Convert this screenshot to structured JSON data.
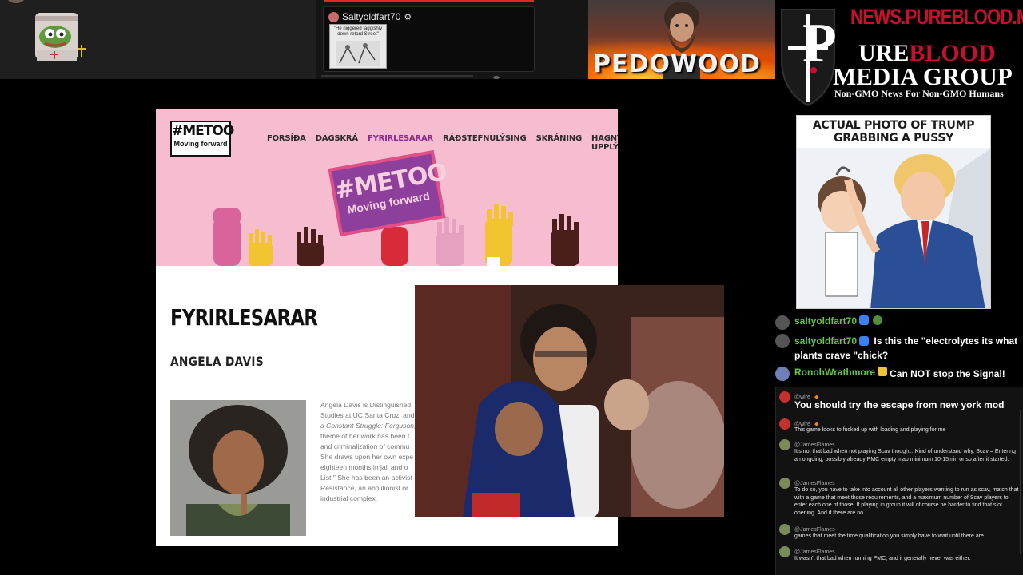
{
  "top_left": {
    "pepe_alt": ""
  },
  "mini_card": {
    "username": "Saltyoldfart70",
    "meme_caption": "\"He niggered faggishly down retard Street\""
  },
  "banner": {
    "text": "PEDOWOOD"
  },
  "logo": {
    "site": "NEWS.PUREBLOOD.MEDIA",
    "initial": "P",
    "line1_white": "URE",
    "line1_red": "BLOOD",
    "line2": "MEDIA GROUP",
    "tagline": "Non-GMO News For Non-GMO Humans"
  },
  "site": {
    "logo_main": "#METOO",
    "logo_sub": "Moving forward",
    "nav": [
      "FORSÍÐA",
      "DAGSKRÁ",
      "FYRIRLESARAR",
      "RÁÐSTEFNULÝSING",
      "SKRÁNING",
      "HAGNÝTAR UPPLÝSINGAR"
    ],
    "sign_main": "#METOO",
    "sign_sub": "Moving forward",
    "page_title": "FYRIRLESARAR",
    "person_name": "ANGELA DAVIS",
    "bio_lines": [
      "Angela Davis is Distinguished",
      "Studies at UC Santa Cruz, and",
      "a Constant Struggle: Ferguson,",
      "theme of her work has been t",
      "and criminalization of commu",
      "She draws upon her own expe",
      "eighteen months in jail and o",
      "List.\" She has been an activist",
      "Resistance, an abolitionist or",
      "industrial complex."
    ]
  },
  "trump_meme": {
    "caption_l1": "ACTUAL PHOTO OF TRUMP",
    "caption_l2": "GRABBING A PUSSY"
  },
  "chat": {
    "rows": [
      {
        "name": "saltyoldfart70",
        "message": ""
      },
      {
        "name": "saltyoldfart70",
        "message": "Is this the \"electrolytes its what plants crave \"chick?"
      },
      {
        "name": "RonohWrathmore",
        "message": "Can NOT stop the Signal!"
      }
    ],
    "panel": [
      {
        "user": "@wire",
        "text": "You should try the escape from new york mod"
      },
      {
        "user": "@wire",
        "text": "This game looks to fucked up with loading and playing for me"
      },
      {
        "user": "@JamesFlames",
        "text": "It's not that bad when not playing Scav though... Kind of understand why. Scav = Entering an ongoing, possibly already PMC empty map minimum 10-15min or so after it started."
      },
      {
        "user": "@JamesFlames",
        "text": "To do so, you have to take into account all other players wanting to run as scav, match that with a game that meet those requirements, and a maximum number of Scav players to enter each one of those. If playing in group it will of course be harder to find that slot opening. And if there are no"
      },
      {
        "user": "@JamesFlames",
        "text": "games that meet the time qualification you simply have to wait until there are."
      },
      {
        "user": "@JamesFlames",
        "text": "It wasn't that bad when running PMC, and it generally never was either."
      }
    ]
  }
}
